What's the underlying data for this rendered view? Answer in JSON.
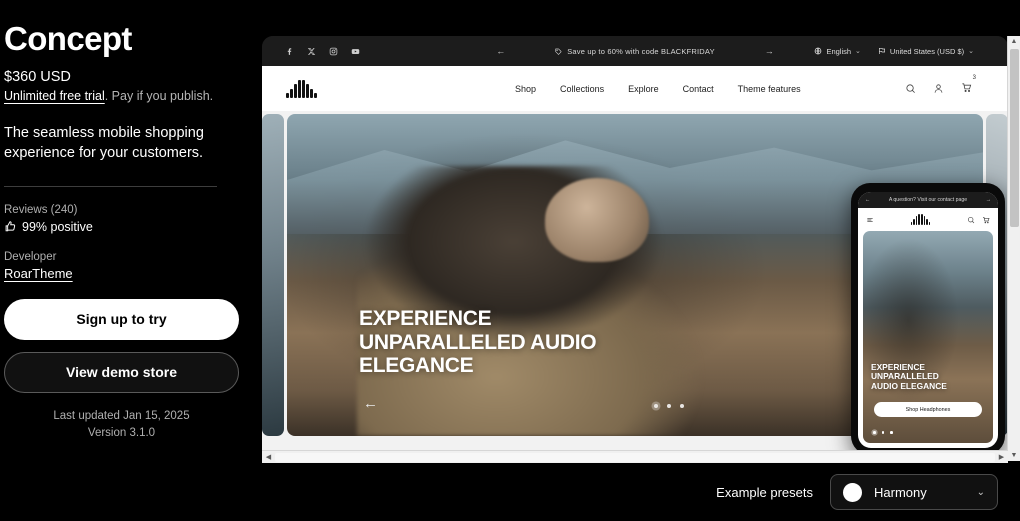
{
  "theme": {
    "title": "Concept",
    "price": "$360 USD",
    "trial_link": "Unlimited free trial",
    "trial_rest": ". Pay if you publish.",
    "tagline": "The seamless mobile shopping experience for your customers.",
    "reviews_label": "Reviews (240)",
    "rating_text": "99% positive",
    "developer_label": "Developer",
    "developer_name": "RoarTheme",
    "primary_button": "Sign up to try",
    "secondary_button": "View demo store",
    "last_updated": "Last updated Jan 15, 2025",
    "version": "Version 3.1.0"
  },
  "preview": {
    "announcement": {
      "message": "Save up to 60% with code BLACKFRIDAY",
      "prev_arrow": "←",
      "next_arrow": "→",
      "socials": [
        "facebook-icon",
        "x-icon",
        "instagram-icon",
        "youtube-icon"
      ],
      "language": "English",
      "currency": "United States (USD $)",
      "chevron": "⌄"
    },
    "store_nav": [
      "Shop",
      "Collections",
      "Explore",
      "Contact",
      "Theme features"
    ],
    "header_icons": [
      "search-icon",
      "account-icon",
      "cart-icon"
    ],
    "cart_count": "3",
    "hero": {
      "headline_line1": "EXPERIENCE",
      "headline_line2": "UNPARALLELED AUDIO",
      "headline_line3": "ELEGANCE",
      "prev_arrow": "←",
      "dots": 3,
      "active_dot": 0
    }
  },
  "phone": {
    "announcement": "A question? Visit our contact page",
    "prev_arrow": "←",
    "next_arrow": "→",
    "hero_line1": "EXPERIENCE",
    "hero_line2": "UNPARALLELED",
    "hero_line3": "AUDIO ELEGANCE",
    "cta": "Shop Headphones",
    "dots": 3,
    "active_dot": 0
  },
  "bottom": {
    "presets_label": "Example presets",
    "selected_preset": "Harmony",
    "chevron": "⌄"
  },
  "scrollbars": {
    "up_arrow": "▲",
    "down_arrow": "▼",
    "left_arrow": "◀",
    "right_arrow": "▶"
  },
  "colors": {
    "background": "#000000",
    "panel_text": "#ffffff",
    "muted_text": "#b0b0b0",
    "accent_white": "#ffffff"
  }
}
